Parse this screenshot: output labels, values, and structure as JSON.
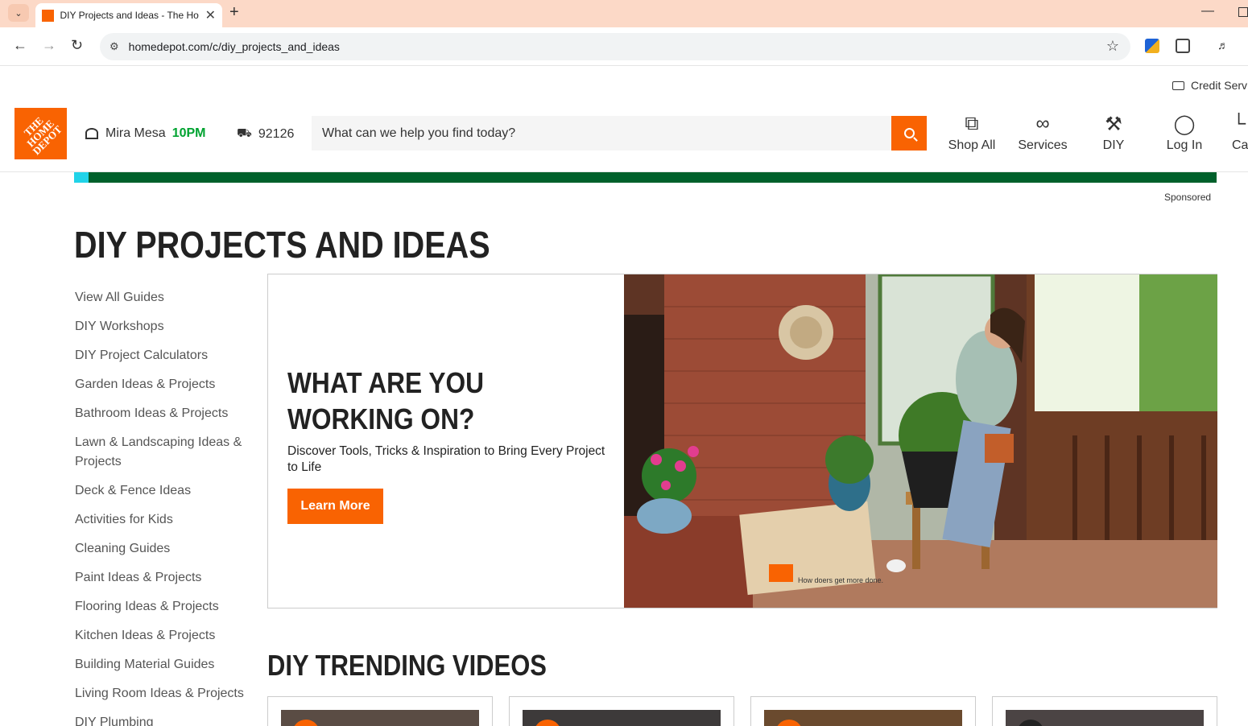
{
  "browser": {
    "tab_title": "DIY Projects and Ideas - The Ho",
    "url": "homedepot.com/c/diy_projects_and_ideas"
  },
  "header": {
    "credit_label": "Credit Serv",
    "logo_text": "THE HOME DEPOT",
    "store_name": "Mira Mesa",
    "store_hours": "10PM",
    "zip": "92126",
    "search_placeholder": "What can we help you find today?",
    "nav": [
      {
        "label": "Shop All",
        "icon": "shop-all-icon"
      },
      {
        "label": "Services",
        "icon": "services-icon"
      },
      {
        "label": "DIY",
        "icon": "diy-hammer-icon"
      },
      {
        "label": "Log In",
        "icon": "user-icon"
      },
      {
        "label": "Ca",
        "icon": "cart-icon"
      }
    ]
  },
  "colors": {
    "brand_orange": "#f96302",
    "banner_green": "#00602b",
    "hours_green": "#00a330"
  },
  "sponsored_label": "Sponsored",
  "page_title": "DIY PROJECTS AND IDEAS",
  "sidebar": {
    "links": [
      "View All Guides",
      "DIY Workshops",
      "DIY Project Calculators",
      "Garden Ideas & Projects",
      "Bathroom Ideas & Projects",
      "Lawn & Landscaping Ideas & Projects",
      "Deck & Fence Ideas",
      "Activities for Kids",
      "Cleaning Guides",
      "Paint Ideas & Projects",
      "Flooring Ideas & Projects",
      "Kitchen Ideas & Projects",
      "Building Material Guides",
      "Living Room Ideas & Projects",
      "DIY Plumbing"
    ]
  },
  "hero": {
    "heading": "WHAT ARE YOU WORKING ON?",
    "subtext": "Discover Tools, Tricks & Inspiration to Bring Every Project to Life",
    "cta": "Learn More",
    "box_print": "How doers get more done."
  },
  "videos_title": "DIY TRENDING VIDEOS"
}
